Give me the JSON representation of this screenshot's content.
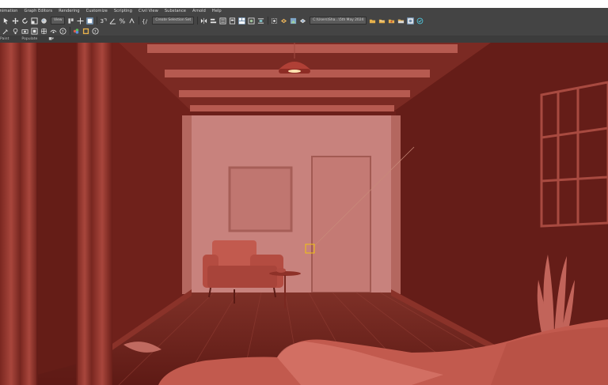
{
  "menubar": {
    "items": [
      "Animation",
      "Graph Editors",
      "Rendering",
      "Customize",
      "Scripting",
      "Civil View",
      "Substance",
      "Arnold",
      "Help"
    ]
  },
  "toolbar": {
    "view_dropdown": "View",
    "selection_set_dropdown": "Create Selection Set",
    "path_dropdown": "C:\\Users\\Sha...\\5th May 2024"
  },
  "ribbon": {
    "tabs": [
      "Paint",
      "Populate"
    ]
  },
  "icons": {
    "toolbar1": [
      "select-icon",
      "move-icon",
      "rotate-icon",
      "scale-icon",
      "place-icon",
      "snaps-icon",
      "angle-snap-icon",
      "percent-snap-icon",
      "spinner-snap-icon",
      "mirror-icon",
      "align-icon",
      "layer-icon",
      "scene-explorer-icon",
      "schematic-view-icon",
      "material-editor-icon",
      "render-setup-icon",
      "render-frame-icon",
      "render-icon",
      "viewport-config-icon",
      "help-icon"
    ],
    "toolbar2": [
      "link-icon",
      "unlink-icon",
      "bind-icon",
      "light-icon",
      "camera-icon",
      "helper-icon",
      "help-icon"
    ]
  },
  "colors": {
    "ui_dark": "#444444",
    "viewport_wall": "#6b1f1a",
    "accent": "#6f8ba8"
  }
}
